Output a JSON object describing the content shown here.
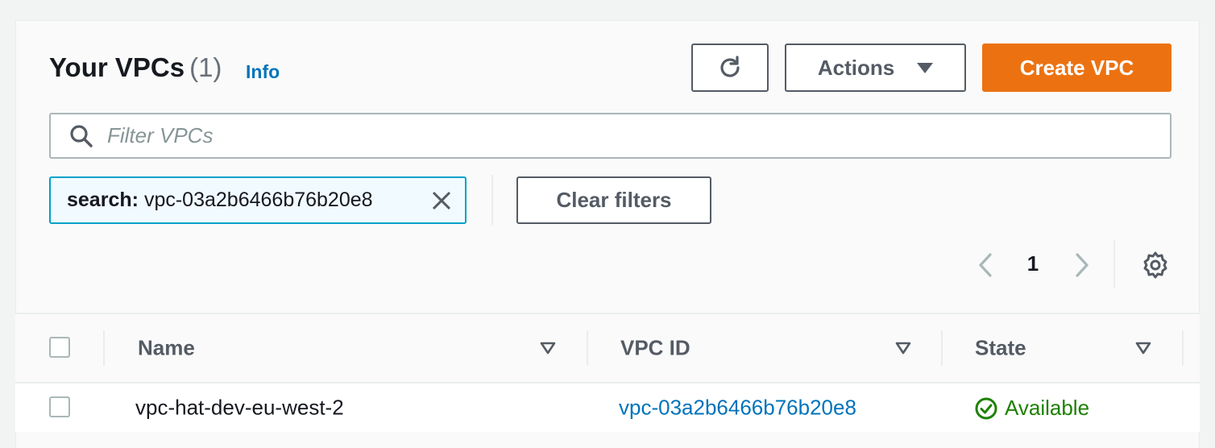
{
  "header": {
    "title": "Your VPCs",
    "count": "(1)",
    "info_label": "Info"
  },
  "toolbar": {
    "refresh_icon": "refresh-icon",
    "actions_label": "Actions",
    "create_label": "Create VPC"
  },
  "filter": {
    "placeholder": "Filter VPCs",
    "value": "",
    "token_key": "search:",
    "token_value": "vpc-03a2b6466b76b20e8",
    "clear_label": "Clear filters"
  },
  "pagination": {
    "current_page": "1"
  },
  "table": {
    "columns": [
      {
        "label": "Name"
      },
      {
        "label": "VPC ID"
      },
      {
        "label": "State"
      }
    ],
    "rows": [
      {
        "name": "vpc-hat-dev-eu-west-2",
        "vpc_id": "vpc-03a2b6466b76b20e8",
        "state": "Available"
      }
    ]
  },
  "colors": {
    "primary": "#ec7211",
    "link": "#0073bb",
    "success": "#1d8102",
    "token_border": "#00a1c9"
  }
}
